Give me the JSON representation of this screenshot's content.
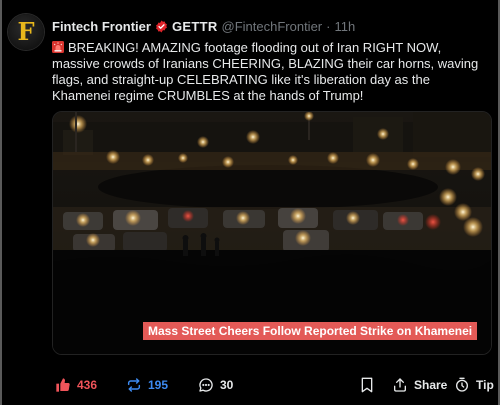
{
  "post": {
    "avatar_letter": "F",
    "display_name": "Fintech Frontier",
    "platform": "GETTR",
    "handle": "@FintechFrontier",
    "separator": "·",
    "time": "11h",
    "text": "BREAKING! AMAZING footage flooding out of Iran RIGHT NOW, massive crowds of Iranians CHEERING, BLAZING their car horns, waving flags, and straight-up CELEBRATING like it's liberation day as the Khamenei regime CRUMBLES at the hands of Trump!",
    "media_caption": "Mass Street Cheers Follow Reported Strike on Khamenei"
  },
  "actions": {
    "likes": "436",
    "reposts": "195",
    "replies": "30",
    "share_label": "Share",
    "tip_label": "Tip"
  },
  "colors": {
    "accent_red": "#f0545a",
    "accent_blue": "#3d8bf2",
    "verified_red": "#e0242a",
    "caption_bg": "#e35a57",
    "avatar_gold": "#e9b81c"
  },
  "icons": {
    "siren": "police-car-light-icon",
    "verified": "verified-badge-icon",
    "like": "thumbs-up-icon",
    "repost": "repost-icon",
    "reply": "comment-icon",
    "bookmark": "bookmark-icon",
    "share": "share-icon",
    "tip": "tip-icon"
  }
}
